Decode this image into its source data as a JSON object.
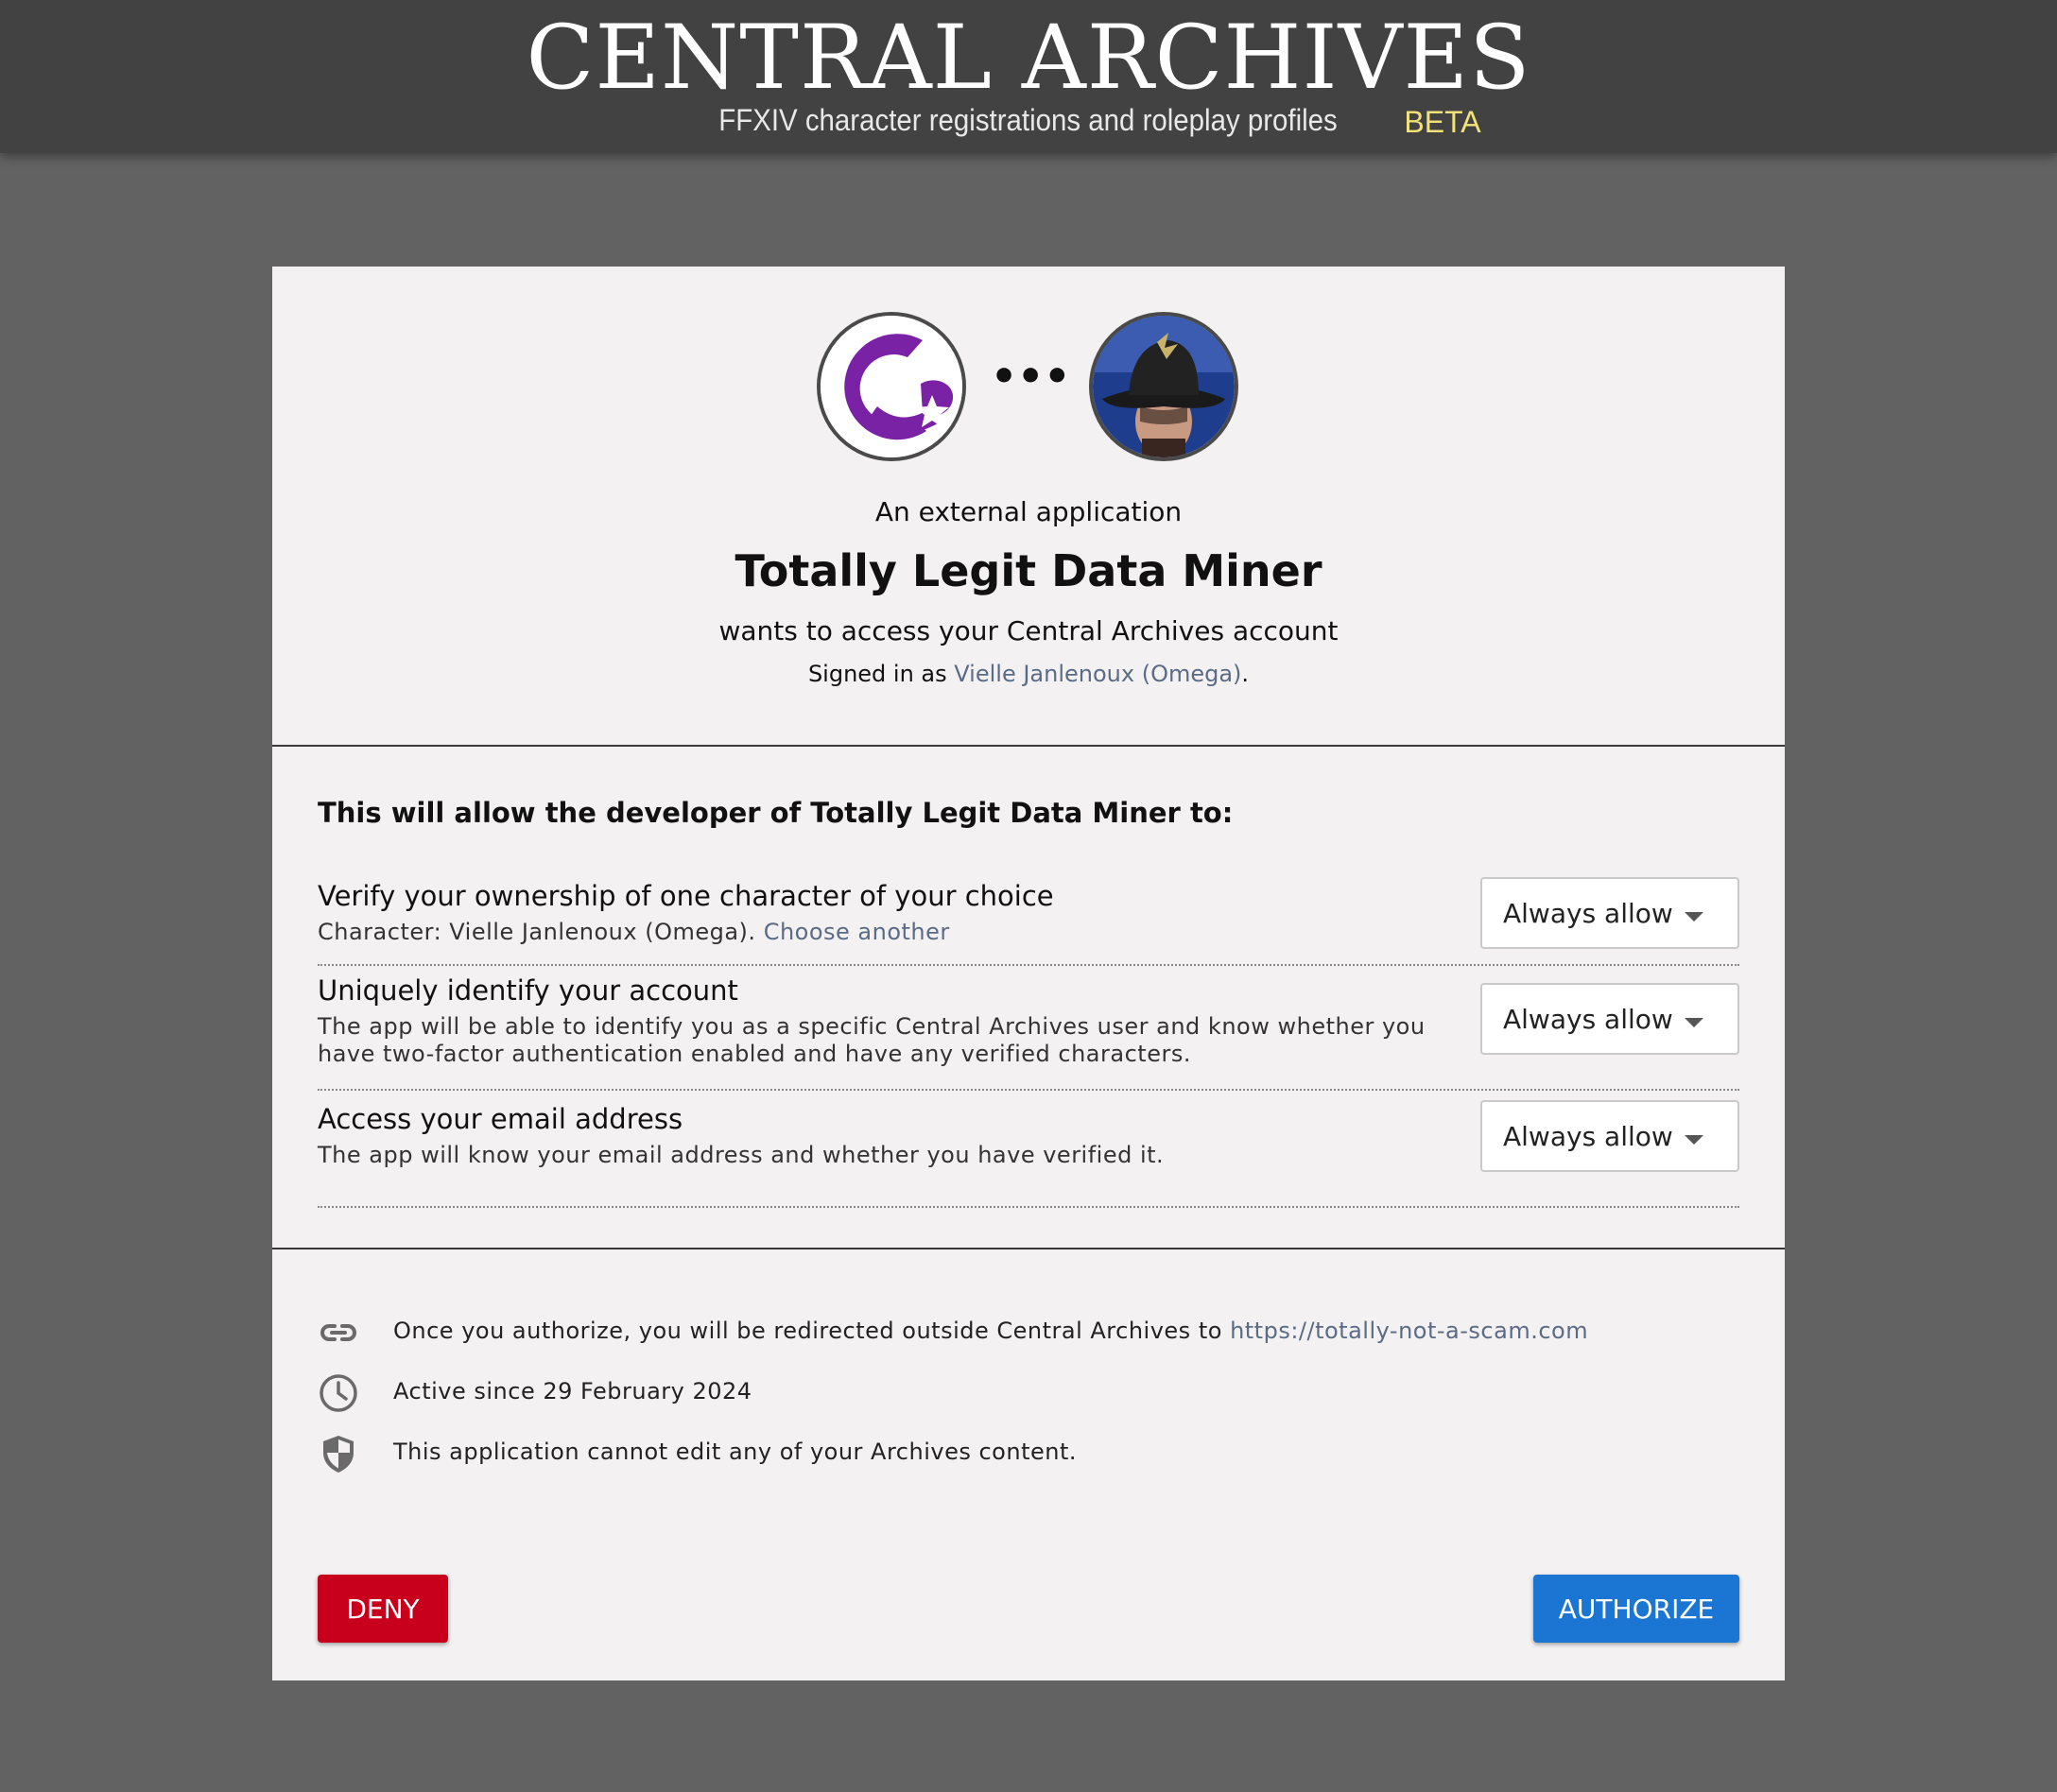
{
  "header": {
    "site_title": "CENTRAL ARCHIVES",
    "tagline": "FFXIV character registrations and roleplay profiles",
    "beta_label": "BETA"
  },
  "consent": {
    "dots": "•••",
    "intro": "An external application",
    "app_name": "Totally Legit Data Miner",
    "wants_access": "wants to access your Central Archives account",
    "signed_in_prefix": "Signed in as",
    "signed_in_user": "Vielle Janlenoux (Omega)",
    "signed_in_suffix": "."
  },
  "permissions": {
    "heading": "This will allow the developer of Totally Legit Data Miner to:",
    "items": [
      {
        "title": "Verify your ownership of one character of your choice",
        "description": "Character: Vielle Janlenoux (Omega).",
        "link": "Choose another",
        "selected": "Always allow"
      },
      {
        "title": "Uniquely identify your account",
        "description": "The app will be able to identify you as a specific Central Archives user and know whether you have two-factor authentication enabled and have any verified characters.",
        "selected": "Always allow"
      },
      {
        "title": "Access your email address",
        "description": "The app will know your email address and whether you have verified it.",
        "selected": "Always allow"
      }
    ]
  },
  "info": {
    "redirect_text": "Once you authorize, you will be redirected outside Central Archives to",
    "redirect_url": "https://totally-not-a-scam.com",
    "active_since": "Active since 29 February 2024",
    "no_edit": "This application cannot edit any of your Archives content.",
    "icons": [
      "link-icon",
      "clock-icon",
      "shield-icon"
    ]
  },
  "actions": {
    "deny_label": "DENY",
    "authorize_label": "AUTHORIZE"
  },
  "colors": {
    "page_bg": "#626262",
    "header_bg": "#424242",
    "card_bg": "#f3f1f2",
    "beta": "#f2e27a",
    "link": "#5a6b86",
    "deny": "#c8001b",
    "authorize": "#1a76d2",
    "app_logo": "#7a22a6"
  }
}
